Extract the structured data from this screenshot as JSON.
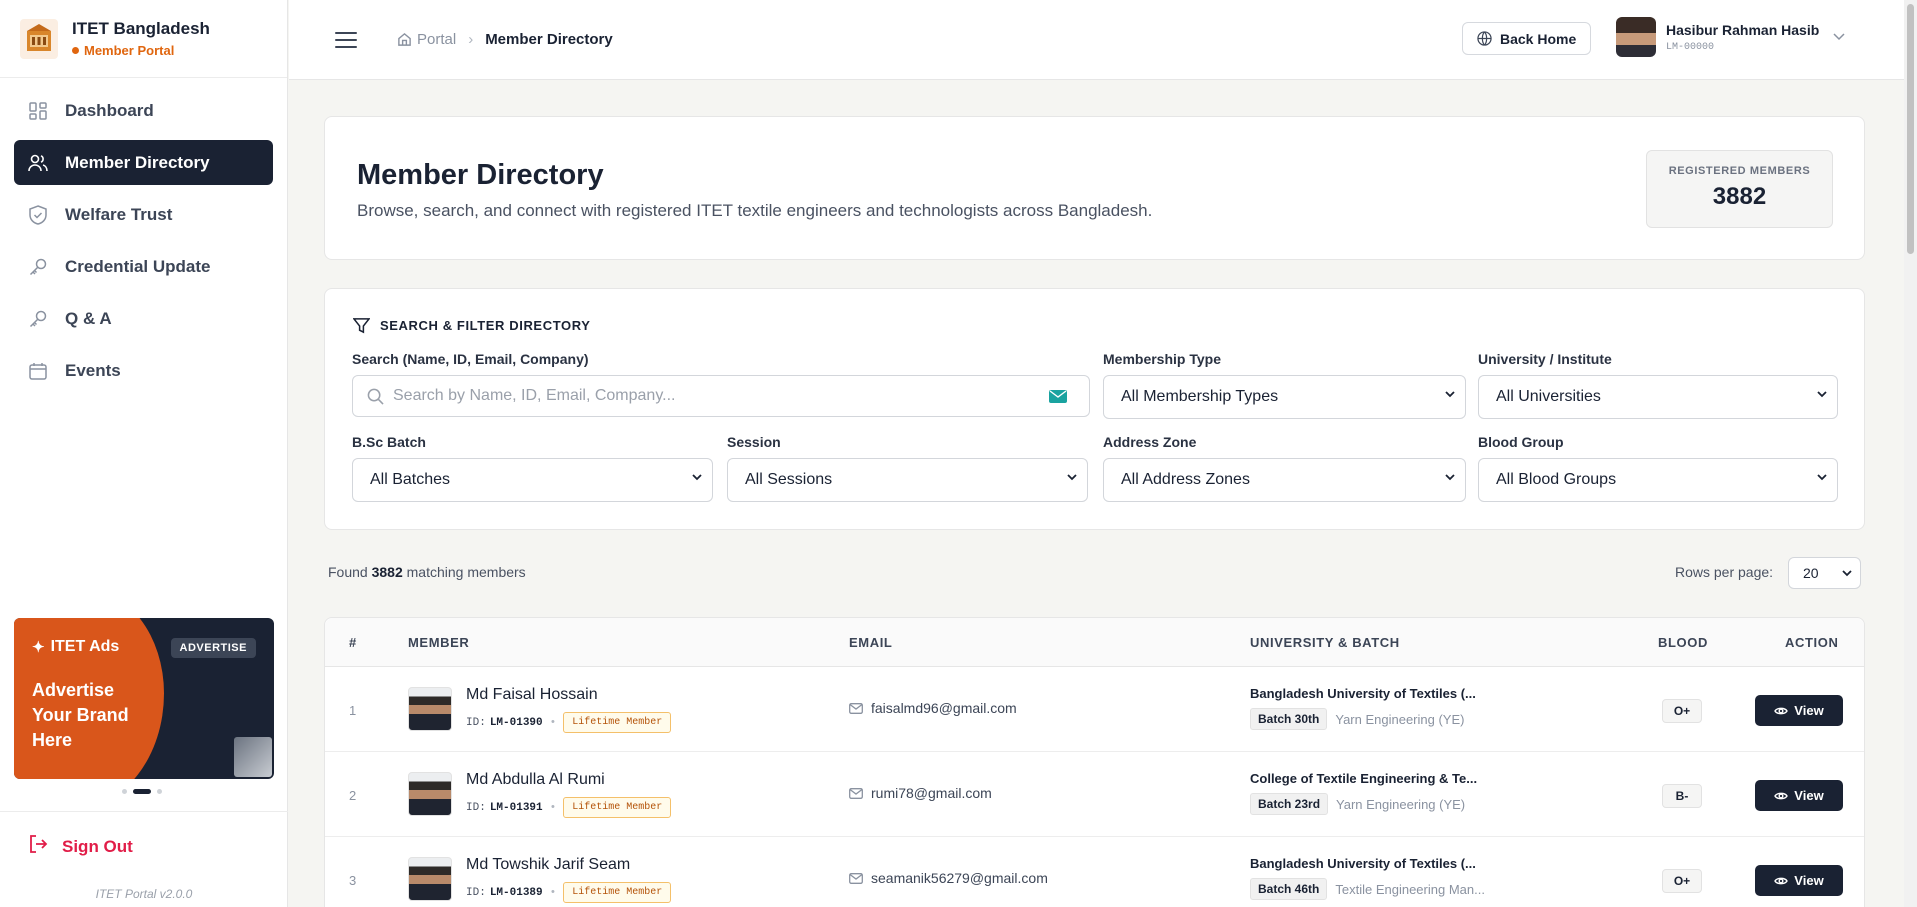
{
  "brand": {
    "title": "ITET Bangladesh",
    "subtitle": "Member Portal"
  },
  "nav": [
    {
      "label": "Dashboard",
      "icon": "grid-icon",
      "active": false
    },
    {
      "label": "Member Directory",
      "icon": "users-icon",
      "active": true
    },
    {
      "label": "Welfare Trust",
      "icon": "shield-icon",
      "active": false
    },
    {
      "label": "Credential Update",
      "icon": "key-icon",
      "active": false
    },
    {
      "label": "Q & A",
      "icon": "key-icon",
      "active": false
    },
    {
      "label": "Events",
      "icon": "calendar-icon",
      "active": false
    }
  ],
  "ad": {
    "head": "ITET Ads",
    "badge": "ADVERTISE",
    "text": "Advertise Your Brand Here"
  },
  "signout": "Sign Out",
  "version": "ITET Portal v2.0.0",
  "topbar": {
    "crumb_root": "Portal",
    "crumb_current": "Member Directory",
    "back_home": "Back Home",
    "user_name": "Hasibur Rahman Hasib",
    "user_id": "LM-00000"
  },
  "hero": {
    "title": "Member Directory",
    "description": "Browse, search, and connect with registered ITET textile engineers and technologists across Bangladesh.",
    "stat_label": "REGISTERED MEMBERS",
    "stat_value": "3882"
  },
  "filters": {
    "title": "SEARCH & FILTER DIRECTORY",
    "search_label": "Search (Name, ID, Email, Company)",
    "search_placeholder": "Search by Name, ID, Email, Company...",
    "membership_label": "Membership Type",
    "membership_value": "All Membership Types",
    "university_label": "University / Institute",
    "university_value": "All Universities",
    "batch_label": "B.Sc Batch",
    "batch_value": "All Batches",
    "session_label": "Session",
    "session_value": "All Sessions",
    "zone_label": "Address Zone",
    "zone_value": "All Address Zones",
    "blood_label": "Blood Group",
    "blood_value": "All Blood Groups"
  },
  "results": {
    "found_prefix": "Found",
    "found_count": "3882",
    "found_suffix": "matching members",
    "rows_label": "Rows per page:",
    "rows_value": "20"
  },
  "table": {
    "headers": {
      "num": "#",
      "member": "MEMBER",
      "email": "EMAIL",
      "uni": "UNIVERSITY & BATCH",
      "blood": "BLOOD",
      "action": "ACTION"
    },
    "id_prefix": "ID:",
    "view_label": "View",
    "rows": [
      {
        "num": "1",
        "name": "Md Faisal Hossain",
        "id": "LM-01390",
        "type": "Lifetime Member",
        "email": "faisalmd96@gmail.com",
        "university": "Bangladesh University of Textiles (...",
        "batch": "Batch 30th",
        "dept": "Yarn Engineering (YE)",
        "blood": "O+"
      },
      {
        "num": "2",
        "name": "Md Abdulla Al Rumi",
        "id": "LM-01391",
        "type": "Lifetime Member",
        "email": "rumi78@gmail.com",
        "university": "College of Textile Engineering & Te...",
        "batch": "Batch 23rd",
        "dept": "Yarn Engineering (YE)",
        "blood": "B-"
      },
      {
        "num": "3",
        "name": "Md Towshik Jarif Seam",
        "id": "LM-01389",
        "type": "Lifetime Member",
        "email": "seamanik56279@gmail.com",
        "university": "Bangladesh University of Textiles (...",
        "batch": "Batch 46th",
        "dept": "Textile Engineering Man...",
        "blood": "O+"
      }
    ]
  }
}
